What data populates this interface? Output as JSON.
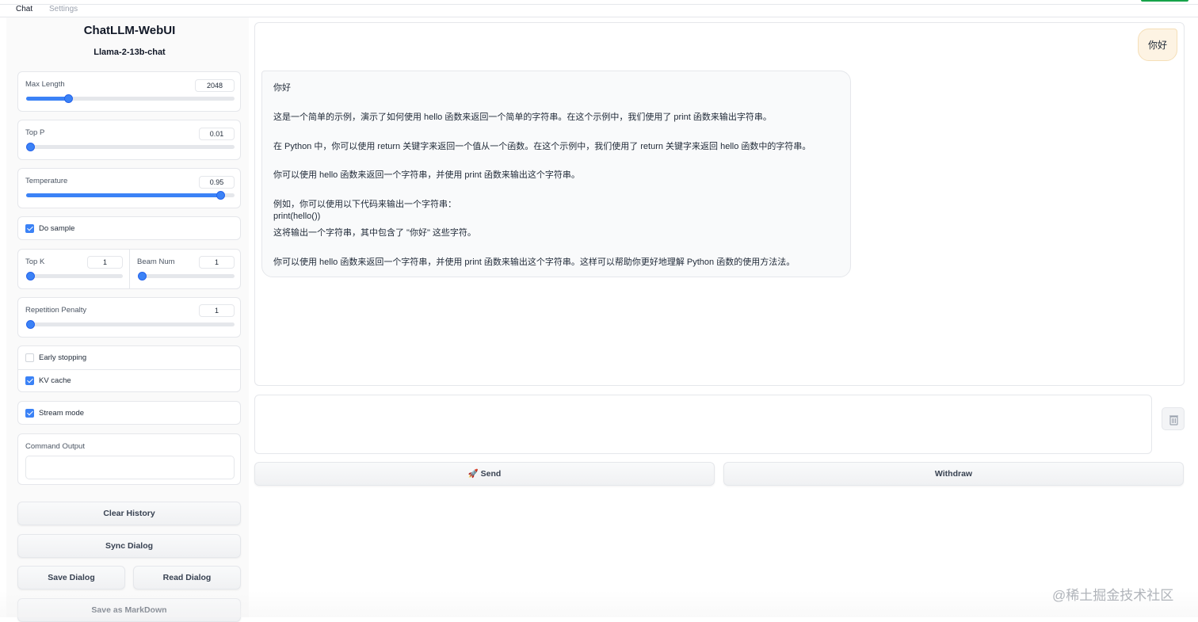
{
  "tabs": [
    {
      "label": "Chat"
    },
    {
      "label": "Settings"
    }
  ],
  "app": {
    "title": "ChatLLM-WebUI",
    "model": "Llama-2-13b-chat"
  },
  "params": {
    "max_length": {
      "label": "Max Length",
      "value": "2048",
      "fraction": 0.2
    },
    "top_p": {
      "label": "Top P",
      "value": "0.01",
      "fraction": 0.0
    },
    "temperature": {
      "label": "Temperature",
      "value": "0.95",
      "fraction": 0.93
    },
    "do_sample": {
      "label": "Do sample",
      "checked": true
    },
    "top_k": {
      "label": "Top K",
      "value": "1",
      "fraction": 0.0
    },
    "beam_num": {
      "label": "Beam Num",
      "value": "1",
      "fraction": 0.0
    },
    "repetition_penalty": {
      "label": "Repetition Penalty",
      "value": "1",
      "fraction": 0.0
    },
    "early_stopping": {
      "label": "Early stopping",
      "checked": false
    },
    "kv_cache": {
      "label": "KV cache",
      "checked": true
    },
    "stream_mode": {
      "label": "Stream mode",
      "checked": true
    },
    "command_output": {
      "label": "Command Output",
      "value": ""
    }
  },
  "buttons": {
    "clear_history": "Clear History",
    "sync_dialog": "Sync Dialog",
    "save_dialog": "Save Dialog",
    "read_dialog": "Read Dialog",
    "save_markdown": "Save as MarkDown",
    "send": "🚀 Send",
    "withdraw": "Withdraw"
  },
  "chat": {
    "user_message": "你好",
    "bot_lines": [
      "你好",
      "这是一个简单的示例，演示了如何使用 hello 函数来返回一个简单的字符串。在这个示例中，我们使用了 print 函数来输出字符串。",
      "在 Python 中，你可以使用 return 关键字来返回一个值从一个函数。在这个示例中，我们使用了 return 关键字来返回 hello 函数中的字符串。",
      "你可以使用 hello 函数来返回一个字符串，并使用 print 函数来输出这个字符串。",
      "例如，你可以使用以下代码来输出一个字符串：",
      "print(hello())",
      "这将输出一个字符串，其中包含了 \"你好\" 这些字符。",
      "你可以使用 hello 函数来返回一个字符串，并使用 print 函数来输出这个字符串。这样可以帮助你更好地理解 Python 函数的使用方法法。"
    ]
  },
  "input": {
    "value": ""
  },
  "watermark": "@稀土掘金技术社区",
  "colors": {
    "accent": "#3b82f6",
    "user_bubble": "#fdf3e3",
    "active_indicator": "#16a34a"
  }
}
